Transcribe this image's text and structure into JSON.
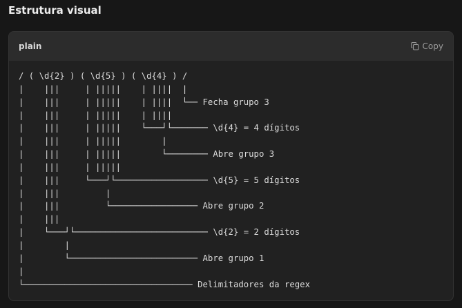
{
  "section": {
    "title": "Estrutura visual"
  },
  "code_block": {
    "language": "plain",
    "copy_label": "Copy",
    "icon": "copy-icon",
    "lines": [
      "/ ( \\d{2} ) ( \\d{5} ) ( \\d{4} ) /",
      "|    |||     | |||||    | ||||  |",
      "|    |||     | |||||    | ||||  └── Fecha grupo 3",
      "|    |||     | |||||    | ||||",
      "|    |||     | |||||    └───┘└─────── \\d{4} = 4 dígitos",
      "|    |||     | |||||        |",
      "|    |||     | |||||        └──────── Abre grupo 3",
      "|    |||     | |||||",
      "|    |||     └───┘└────────────────── \\d{5} = 5 dígitos",
      "|    |||         |",
      "|    |||         └───────────────── Abre grupo 2",
      "|    |||",
      "|    └───┘└────────────────────────── \\d{2} = 2 dígitos",
      "|        |",
      "|        └───────────────────────── Abre grupo 1",
      "|",
      "└───────────────────────────────── Delimitadores da regex"
    ]
  }
}
